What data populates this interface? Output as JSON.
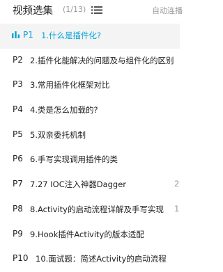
{
  "header": {
    "title": "视频选集",
    "count": "(1/13)",
    "autoplay_label": "自动连播"
  },
  "colors": {
    "accent": "#00a1d6",
    "active_background": "#f4f4f4",
    "muted_text": "#999999"
  },
  "icons": {
    "list_toggle": "list-icon",
    "now_playing": "playing-bars-icon"
  },
  "episodes": [
    {
      "ep": "P1",
      "title": "1.什么是插件化?",
      "duration": ""
    },
    {
      "ep": "P2",
      "title": "2.插件化能解决的问题及与组件化的区别",
      "duration": ""
    },
    {
      "ep": "P3",
      "title": "3.常用插件化框架对比",
      "duration": ""
    },
    {
      "ep": "P4",
      "title": "4.类是怎么加载的?",
      "duration": ""
    },
    {
      "ep": "P5",
      "title": "5.双亲委托机制",
      "duration": ""
    },
    {
      "ep": "P6",
      "title": "6.手写实现调用插件的类",
      "duration": ""
    },
    {
      "ep": "P7",
      "title": "7.27 IOC注入神器Dagger",
      "duration": "2:"
    },
    {
      "ep": "P8",
      "title": "8.Activity的启动流程详解及手写实现",
      "duration": "1:"
    },
    {
      "ep": "P9",
      "title": "9.Hook插件Activity的版本适配",
      "duration": ""
    },
    {
      "ep": "P10",
      "title": "10.面试题：简述Activity的启动流程",
      "duration": ""
    }
  ]
}
